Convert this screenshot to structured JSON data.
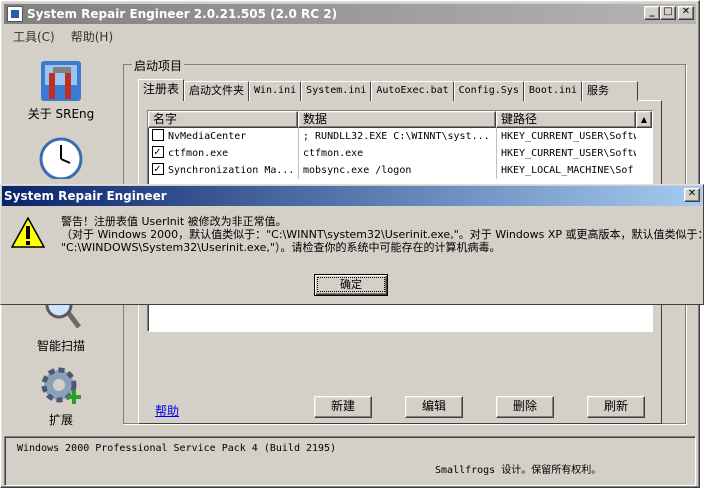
{
  "window": {
    "title": "System Repair Engineer 2.0.21.505 (2.0 RC 2)"
  },
  "menu": [
    "工具(C)",
    "帮助(H)"
  ],
  "sidebar": {
    "items": [
      {
        "label": "关于 SREng",
        "icon": "tools-icon"
      },
      {
        "label": "智能扫描",
        "icon": "magnifier-icon"
      },
      {
        "label": "扩展",
        "icon": "gear-plus-icon"
      }
    ]
  },
  "group": {
    "label": "启动项目"
  },
  "tabs": [
    "注册表",
    "启动文件夹",
    "Win.ini",
    "System.ini",
    "AutoExec.bat",
    "Config.Sys",
    "Boot.ini",
    "服务"
  ],
  "list": {
    "columns": [
      "名字",
      "数据",
      "键路径"
    ],
    "rows": [
      {
        "checked": false,
        "name": "NvMediaCenter",
        "data": "; RUNDLL32.EXE C:\\WINNT\\syst...",
        "path": "HKEY_CURRENT_USER\\Softw"
      },
      {
        "checked": true,
        "name": "ctfmon.exe",
        "data": "ctfmon.exe",
        "path": "HKEY_CURRENT_USER\\Softw"
      },
      {
        "checked": true,
        "name": "Synchronization Ma...",
        "data": "mobsync.exe /logon",
        "path": "HKEY_LOCAL_MACHINE\\Sof"
      }
    ]
  },
  "buttons": {
    "help": "帮助",
    "new": "新建",
    "edit": "编辑",
    "delete": "删除",
    "refresh": "刷新"
  },
  "status": {
    "os": "Windows 2000 Professional Service Pack 4 (Build 2195)",
    "copyright": "Smallfrogs 设计。保留所有权利。"
  },
  "dialog": {
    "title": "System Repair Engineer",
    "line1": "警告！注册表值 UserInit 被修改为非正常值。",
    "line2": "（对于 Windows 2000，默认值类似于：\"C:\\WINNT\\system32\\Userinit.exe,\"。对于 Windows XP 或更高版本，默认值类似于：",
    "line3": "\"C:\\WINDOWS\\System32\\Userinit.exe,\"）。请检查你的系统中可能存在的计算机病毒。",
    "ok": "确定"
  },
  "colors": {
    "face": "#d4d0c8",
    "dialog_title": "#0a246a",
    "inactive_title": "#808080",
    "link": "#0000ee"
  }
}
